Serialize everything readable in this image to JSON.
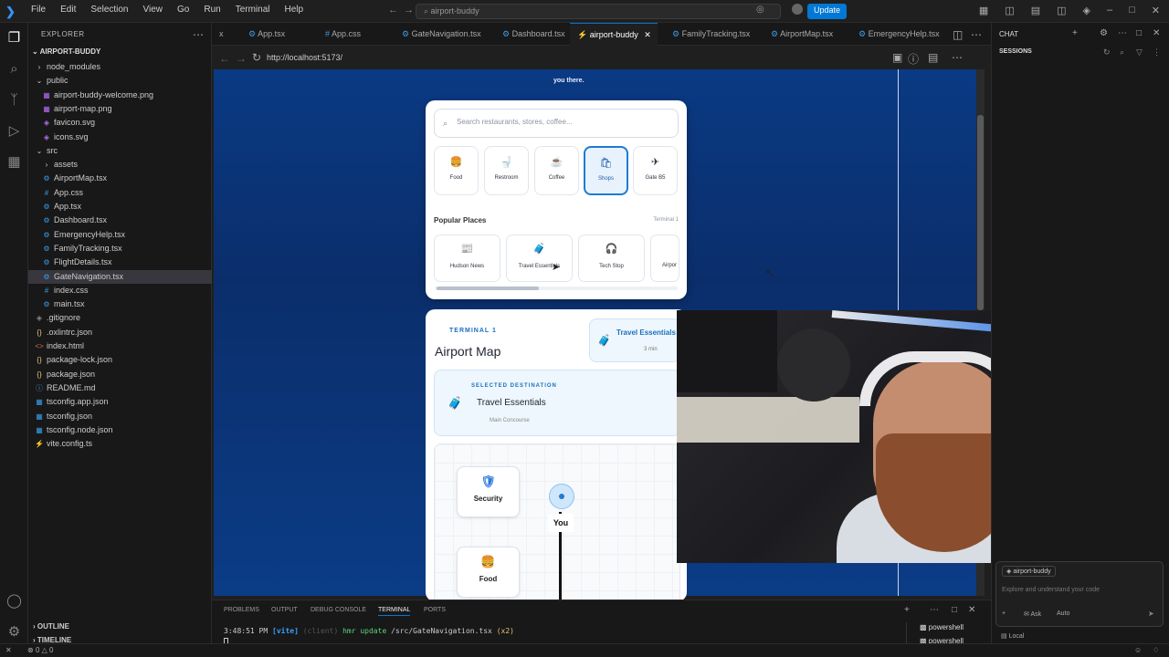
{
  "menu": [
    "File",
    "Edit",
    "Selection",
    "View",
    "Go",
    "Run",
    "Terminal",
    "Help"
  ],
  "title_search": "airport-buddy",
  "update_label": "Update",
  "explorer": {
    "title": "EXPLORER",
    "root": "AIRPORT-BUDDY",
    "items": [
      {
        "label": "node_modules",
        "kind": "folder-closed",
        "depth": 1
      },
      {
        "label": "public",
        "kind": "folder-open",
        "depth": 1
      },
      {
        "label": "airport-buddy-welcome.png",
        "kind": "image",
        "depth": 2
      },
      {
        "label": "airport-map.png",
        "kind": "image",
        "depth": 2
      },
      {
        "label": "favicon.svg",
        "kind": "svg",
        "depth": 2
      },
      {
        "label": "icons.svg",
        "kind": "svg",
        "depth": 2
      },
      {
        "label": "src",
        "kind": "folder-open",
        "depth": 1
      },
      {
        "label": "assets",
        "kind": "folder-closed",
        "depth": 2
      },
      {
        "label": "AirportMap.tsx",
        "kind": "tsx",
        "depth": 2
      },
      {
        "label": "App.css",
        "kind": "css",
        "depth": 2
      },
      {
        "label": "App.tsx",
        "kind": "tsx",
        "depth": 2
      },
      {
        "label": "Dashboard.tsx",
        "kind": "tsx",
        "depth": 2
      },
      {
        "label": "EmergencyHelp.tsx",
        "kind": "tsx",
        "depth": 2
      },
      {
        "label": "FamilyTracking.tsx",
        "kind": "tsx",
        "depth": 2
      },
      {
        "label": "FlightDetails.tsx",
        "kind": "tsx",
        "depth": 2
      },
      {
        "label": "GateNavigation.tsx",
        "kind": "tsx",
        "depth": 2,
        "selected": true
      },
      {
        "label": "index.css",
        "kind": "css",
        "depth": 2
      },
      {
        "label": "main.tsx",
        "kind": "tsx",
        "depth": 2
      },
      {
        "label": ".gitignore",
        "kind": "git",
        "depth": 1
      },
      {
        "label": ".oxlintrc.json",
        "kind": "json",
        "depth": 1
      },
      {
        "label": "index.html",
        "kind": "html",
        "depth": 1
      },
      {
        "label": "package-lock.json",
        "kind": "json",
        "depth": 1
      },
      {
        "label": "package.json",
        "kind": "json",
        "depth": 1
      },
      {
        "label": "README.md",
        "kind": "info",
        "depth": 1
      },
      {
        "label": "tsconfig.app.json",
        "kind": "tsconfig",
        "depth": 1
      },
      {
        "label": "tsconfig.json",
        "kind": "tsconfig",
        "depth": 1
      },
      {
        "label": "tsconfig.node.json",
        "kind": "tsconfig",
        "depth": 1
      },
      {
        "label": "vite.config.ts",
        "kind": "vite",
        "depth": 1
      }
    ],
    "outline": "OUTLINE",
    "timeline": "TIMELINE"
  },
  "tabs": [
    {
      "label": "x",
      "icon": ""
    },
    {
      "label": "App.tsx",
      "icon": "tsx"
    },
    {
      "label": "App.css",
      "icon": "css"
    },
    {
      "label": "GateNavigation.tsx",
      "icon": "tsx"
    },
    {
      "label": "Dashboard.tsx",
      "icon": "tsx"
    },
    {
      "label": "airport-buddy",
      "icon": "vite",
      "active": true
    },
    {
      "label": "FamilyTracking.tsx",
      "icon": "tsx"
    },
    {
      "label": "AirportMap.tsx",
      "icon": "tsx"
    },
    {
      "label": "EmergencyHelp.tsx",
      "icon": "tsx"
    }
  ],
  "browser": {
    "url": "http://localhost:5173/",
    "top_text": "you there."
  },
  "search_card": {
    "placeholder": "Search restaurants, stores, coffee...",
    "categories": [
      {
        "label": "Food",
        "icon": "burger-icon"
      },
      {
        "label": "Restroom",
        "icon": "restroom-icon"
      },
      {
        "label": "Coffee",
        "icon": "coffee-icon"
      },
      {
        "label": "Shops",
        "icon": "shop-icon",
        "active": true
      },
      {
        "label": "Gate B5",
        "icon": "plane-icon"
      }
    ],
    "popular_title": "Popular Places",
    "terminal_tag": "Terminal 1",
    "places": [
      {
        "label": "Hudson News",
        "icon": "newspaper-icon"
      },
      {
        "label": "Travel Essentials",
        "icon": "luggage-icon"
      },
      {
        "label": "Tech Stop",
        "icon": "headphones-icon"
      },
      {
        "label": "Airpor",
        "icon": ""
      }
    ]
  },
  "map_panel": {
    "terminal": "TERMINAL 1",
    "title": "Airport Map",
    "route_badge": {
      "name": "Travel Essentials",
      "time": "3 min"
    },
    "selected_label": "SELECTED DESTINATION",
    "selected_name": "Travel Essentials",
    "selected_sub": "Main Concourse",
    "nodes": [
      {
        "label": "Security",
        "icon": "shield-icon"
      },
      {
        "label": "Food",
        "icon": "burger-icon"
      }
    ],
    "you_label": "You"
  },
  "chat": {
    "title": "CHAT",
    "sessions": "SESSIONS",
    "context_chip": "airport-buddy",
    "placeholder": "Explore and understand your code",
    "mode": "Ask",
    "model": "Auto",
    "footer": "Local"
  },
  "panel": {
    "tabs": [
      "PROBLEMS",
      "OUTPUT",
      "DEBUG CONSOLE",
      "TERMINAL",
      "PORTS"
    ],
    "active_tab": "TERMINAL",
    "log_time": "3:48:51 PM",
    "log_tag": "[vite]",
    "log_client": "(client)",
    "log_msg": "hmr update",
    "log_path": "/src/GateNavigation.tsx",
    "log_count": "(x2)",
    "shells": [
      "powershell",
      "powershell"
    ]
  },
  "status": {
    "errors": "0",
    "warnings": "0"
  },
  "colors": {
    "accent": "#0078d4",
    "browser_bg": "#0b3c86",
    "active_cat": "#1f7bd1"
  }
}
